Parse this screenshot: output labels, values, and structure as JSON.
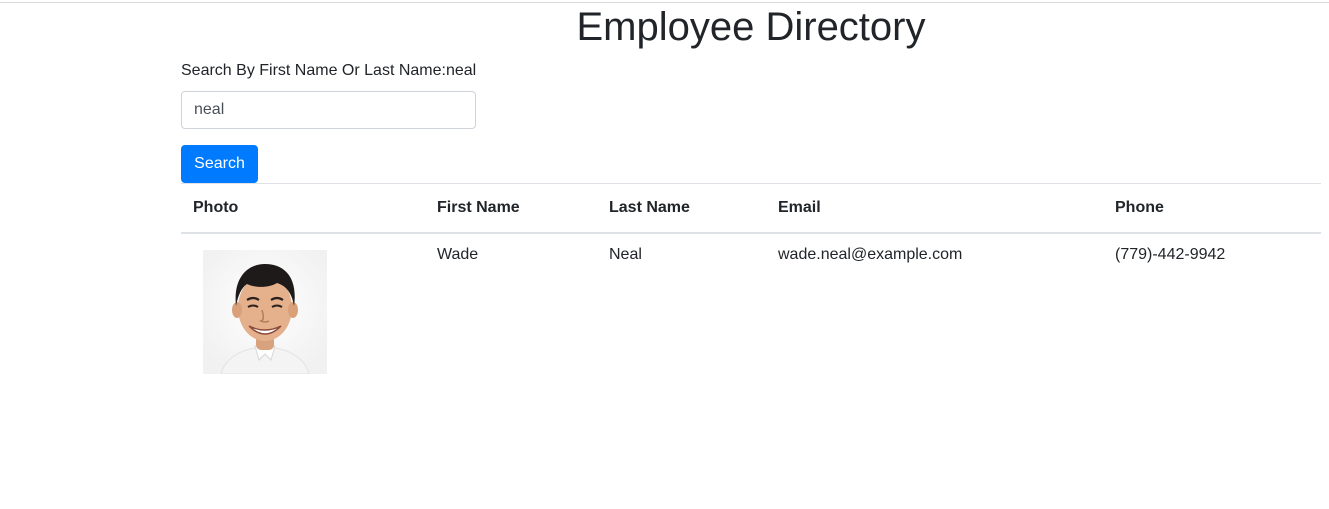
{
  "page": {
    "title": "Employee Directory"
  },
  "search": {
    "label_prefix": "Search By First Name Or Last Name:",
    "label_query": "neal",
    "input_value": "neal",
    "button_label": "Search"
  },
  "table": {
    "headers": [
      "Photo",
      "First Name",
      "Last Name",
      "Email",
      "Phone"
    ],
    "rows": [
      {
        "photo": "employee-portrait",
        "first_name": "Wade",
        "last_name": "Neal",
        "email": "wade.neal@example.com",
        "phone": "(779)-442-9942"
      }
    ]
  },
  "colors": {
    "primary": "#007bff",
    "text": "#212529",
    "border": "#dee2e6"
  }
}
